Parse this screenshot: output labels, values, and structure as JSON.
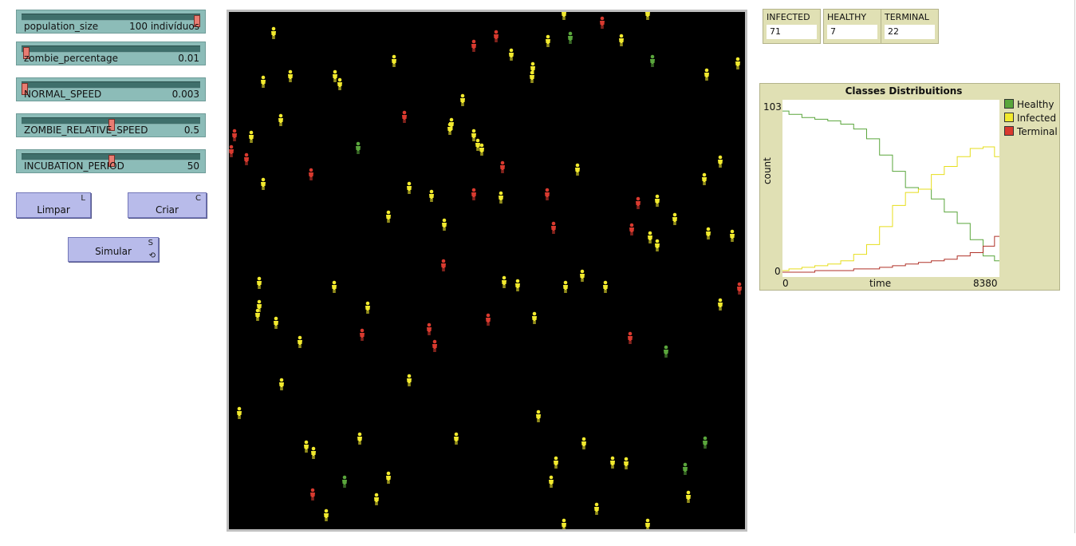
{
  "sliders": [
    {
      "name": "population_size",
      "value": "100 indivíduos",
      "fraction": 0.99
    },
    {
      "name": "zombie_percentage",
      "value": "0.01",
      "fraction": 0.01
    },
    {
      "name": "NORMAL_SPEED",
      "value": "0.003",
      "fraction": 0.0
    },
    {
      "name": "ZOMBIE_RELATIVE_SPEED",
      "value": "0.5",
      "fraction": 0.5
    },
    {
      "name": "INCUBATION_PERIOD",
      "value": "50",
      "fraction": 0.5
    }
  ],
  "buttons": {
    "limpar": {
      "label": "Limpar",
      "key": "L"
    },
    "criar": {
      "label": "Criar",
      "key": "C"
    },
    "simular": {
      "label": "Simular",
      "key": "S",
      "forever": "⟲"
    }
  },
  "monitors": [
    {
      "label": "INFECTED",
      "value": "71"
    },
    {
      "label": "HEALTHY",
      "value": "7"
    },
    {
      "label": "TERMINAL",
      "value": "22"
    }
  ],
  "colors": {
    "healthy": "#5aa63c",
    "infected": "#f2ea2e",
    "terminal": "#d93a2f",
    "background": "#000000"
  },
  "agents": [
    {
      "x": 343,
      "y": 42,
      "c": "infected"
    },
    {
      "x": 330,
      "y": 103,
      "c": "infected"
    },
    {
      "x": 364,
      "y": 96,
      "c": "infected"
    },
    {
      "x": 420,
      "y": 96,
      "c": "infected"
    },
    {
      "x": 426,
      "y": 106,
      "c": "infected"
    },
    {
      "x": 494,
      "y": 77,
      "c": "infected"
    },
    {
      "x": 352,
      "y": 151,
      "c": "infected"
    },
    {
      "x": 315,
      "y": 172,
      "c": "infected"
    },
    {
      "x": 330,
      "y": 231,
      "c": "infected"
    },
    {
      "x": 449,
      "y": 186,
      "c": "healthy"
    },
    {
      "x": 294,
      "y": 170,
      "c": "terminal"
    },
    {
      "x": 290,
      "y": 190,
      "c": "terminal"
    },
    {
      "x": 309,
      "y": 200,
      "c": "terminal"
    },
    {
      "x": 390,
      "y": 219,
      "c": "terminal"
    },
    {
      "x": 507,
      "y": 147,
      "c": "terminal"
    },
    {
      "x": 594,
      "y": 58,
      "c": "terminal"
    },
    {
      "x": 622,
      "y": 46,
      "c": "terminal"
    },
    {
      "x": 641,
      "y": 69,
      "c": "infected"
    },
    {
      "x": 668,
      "y": 86,
      "c": "infected"
    },
    {
      "x": 667,
      "y": 97,
      "c": "infected"
    },
    {
      "x": 687,
      "y": 52,
      "c": "infected"
    },
    {
      "x": 715,
      "y": 48,
      "c": "healthy"
    },
    {
      "x": 755,
      "y": 29,
      "c": "terminal"
    },
    {
      "x": 779,
      "y": 51,
      "c": "infected"
    },
    {
      "x": 707,
      "y": 18,
      "c": "infected"
    },
    {
      "x": 812,
      "y": 18,
      "c": "infected"
    },
    {
      "x": 818,
      "y": 77,
      "c": "healthy"
    },
    {
      "x": 886,
      "y": 94,
      "c": "infected"
    },
    {
      "x": 925,
      "y": 80,
      "c": "infected"
    },
    {
      "x": 580,
      "y": 126,
      "c": "infected"
    },
    {
      "x": 566,
      "y": 156,
      "c": "infected"
    },
    {
      "x": 564,
      "y": 162,
      "c": "infected"
    },
    {
      "x": 594,
      "y": 170,
      "c": "infected"
    },
    {
      "x": 599,
      "y": 182,
      "c": "infected"
    },
    {
      "x": 604,
      "y": 188,
      "c": "infected"
    },
    {
      "x": 630,
      "y": 210,
      "c": "terminal"
    },
    {
      "x": 724,
      "y": 213,
      "c": "infected"
    },
    {
      "x": 903,
      "y": 203,
      "c": "infected"
    },
    {
      "x": 883,
      "y": 225,
      "c": "infected"
    },
    {
      "x": 513,
      "y": 236,
      "c": "infected"
    },
    {
      "x": 541,
      "y": 246,
      "c": "infected"
    },
    {
      "x": 594,
      "y": 244,
      "c": "terminal"
    },
    {
      "x": 628,
      "y": 248,
      "c": "infected"
    },
    {
      "x": 686,
      "y": 244,
      "c": "terminal"
    },
    {
      "x": 800,
      "y": 255,
      "c": "terminal"
    },
    {
      "x": 824,
      "y": 252,
      "c": "infected"
    },
    {
      "x": 846,
      "y": 275,
      "c": "infected"
    },
    {
      "x": 487,
      "y": 272,
      "c": "infected"
    },
    {
      "x": 557,
      "y": 282,
      "c": "infected"
    },
    {
      "x": 694,
      "y": 286,
      "c": "terminal"
    },
    {
      "x": 792,
      "y": 288,
      "c": "terminal"
    },
    {
      "x": 815,
      "y": 298,
      "c": "infected"
    },
    {
      "x": 824,
      "y": 308,
      "c": "infected"
    },
    {
      "x": 888,
      "y": 293,
      "c": "infected"
    },
    {
      "x": 918,
      "y": 296,
      "c": "infected"
    },
    {
      "x": 556,
      "y": 333,
      "c": "terminal"
    },
    {
      "x": 325,
      "y": 355,
      "c": "infected"
    },
    {
      "x": 419,
      "y": 360,
      "c": "infected"
    },
    {
      "x": 632,
      "y": 354,
      "c": "infected"
    },
    {
      "x": 649,
      "y": 358,
      "c": "infected"
    },
    {
      "x": 709,
      "y": 360,
      "c": "infected"
    },
    {
      "x": 730,
      "y": 346,
      "c": "infected"
    },
    {
      "x": 759,
      "y": 360,
      "c": "infected"
    },
    {
      "x": 927,
      "y": 362,
      "c": "terminal"
    },
    {
      "x": 903,
      "y": 382,
      "c": "infected"
    },
    {
      "x": 325,
      "y": 384,
      "c": "infected"
    },
    {
      "x": 323,
      "y": 395,
      "c": "infected"
    },
    {
      "x": 461,
      "y": 386,
      "c": "infected"
    },
    {
      "x": 346,
      "y": 405,
      "c": "infected"
    },
    {
      "x": 376,
      "y": 429,
      "c": "infected"
    },
    {
      "x": 454,
      "y": 420,
      "c": "terminal"
    },
    {
      "x": 538,
      "y": 413,
      "c": "terminal"
    },
    {
      "x": 545,
      "y": 434,
      "c": "terminal"
    },
    {
      "x": 612,
      "y": 401,
      "c": "terminal"
    },
    {
      "x": 670,
      "y": 399,
      "c": "infected"
    },
    {
      "x": 790,
      "y": 424,
      "c": "terminal"
    },
    {
      "x": 835,
      "y": 441,
      "c": "healthy"
    },
    {
      "x": 353,
      "y": 482,
      "c": "infected"
    },
    {
      "x": 513,
      "y": 477,
      "c": "infected"
    },
    {
      "x": 300,
      "y": 518,
      "c": "infected"
    },
    {
      "x": 675,
      "y": 522,
      "c": "infected"
    },
    {
      "x": 451,
      "y": 550,
      "c": "infected"
    },
    {
      "x": 572,
      "y": 550,
      "c": "infected"
    },
    {
      "x": 732,
      "y": 556,
      "c": "infected"
    },
    {
      "x": 884,
      "y": 555,
      "c": "healthy"
    },
    {
      "x": 384,
      "y": 560,
      "c": "infected"
    },
    {
      "x": 393,
      "y": 568,
      "c": "infected"
    },
    {
      "x": 697,
      "y": 580,
      "c": "infected"
    },
    {
      "x": 768,
      "y": 580,
      "c": "infected"
    },
    {
      "x": 785,
      "y": 581,
      "c": "infected"
    },
    {
      "x": 859,
      "y": 588,
      "c": "healthy"
    },
    {
      "x": 432,
      "y": 604,
      "c": "healthy"
    },
    {
      "x": 487,
      "y": 599,
      "c": "infected"
    },
    {
      "x": 691,
      "y": 604,
      "c": "infected"
    },
    {
      "x": 392,
      "y": 620,
      "c": "terminal"
    },
    {
      "x": 472,
      "y": 626,
      "c": "infected"
    },
    {
      "x": 863,
      "y": 623,
      "c": "infected"
    },
    {
      "x": 409,
      "y": 646,
      "c": "infected"
    },
    {
      "x": 748,
      "y": 638,
      "c": "infected"
    },
    {
      "x": 707,
      "y": 658,
      "c": "infected"
    },
    {
      "x": 812,
      "y": 658,
      "c": "infected"
    }
  ],
  "plot": {
    "title": "Classes Distribuitions",
    "xlabel": "time",
    "ylabel": "count",
    "xmin": "0",
    "xmax": "8380",
    "ymin": "0",
    "ymax": "103",
    "legend": [
      {
        "name": "Healthy",
        "color": "#5aa63c"
      },
      {
        "name": "Infected",
        "color": "#f2ea2e"
      },
      {
        "name": "Terminal",
        "color": "#d93a2f"
      }
    ]
  },
  "chart_data": {
    "type": "line",
    "title": "Classes Distribuitions",
    "xlabel": "time",
    "ylabel": "count",
    "xlim": [
      0,
      8380
    ],
    "ylim": [
      0,
      103
    ],
    "x": [
      0,
      500,
      1000,
      1500,
      2000,
      2500,
      3000,
      3500,
      4000,
      4500,
      5000,
      5500,
      6000,
      6500,
      7000,
      7500,
      8000,
      8380
    ],
    "series": [
      {
        "name": "Healthy",
        "values": [
          99,
          97,
          95,
          94,
          93,
          91,
          88,
          82,
          72,
          62,
          52,
          51,
          45,
          37,
          30,
          20,
          10,
          7
        ]
      },
      {
        "name": "Infected",
        "values": [
          1,
          2,
          3,
          4,
          5,
          7,
          11,
          17,
          28,
          41,
          49,
          51,
          60,
          65,
          71,
          76,
          77,
          71
        ]
      },
      {
        "name": "Terminal",
        "values": [
          0,
          0,
          0,
          1,
          1,
          1,
          2,
          2,
          3,
          4,
          5,
          6,
          7,
          8,
          10,
          12,
          16,
          22
        ]
      }
    ],
    "legend_position": "right"
  }
}
